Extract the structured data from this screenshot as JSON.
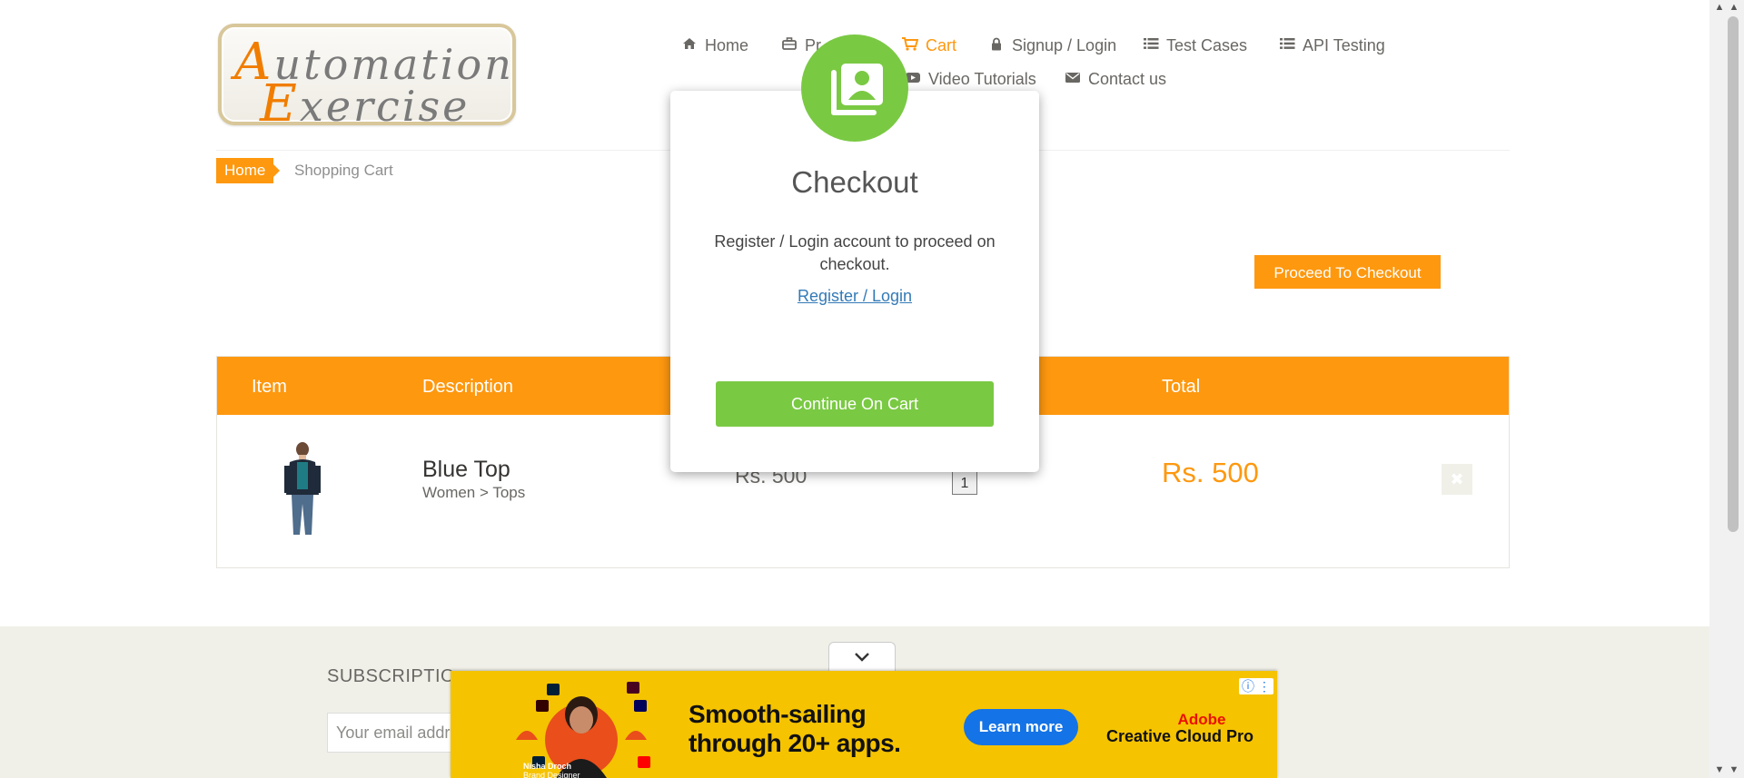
{
  "logo": {
    "line1_cap": "A",
    "line1_rest": "utomation",
    "line2_cap": "E",
    "line2_rest": "xercise"
  },
  "nav": {
    "items": [
      {
        "label": "Home",
        "icon": "home-icon"
      },
      {
        "label": "Pr",
        "icon": "briefcase-icon"
      },
      {
        "label": "Cart",
        "icon": "cart-icon",
        "active": true
      },
      {
        "label": "Signup / Login",
        "icon": "lock-icon"
      },
      {
        "label": "Test Cases",
        "icon": "list-icon"
      },
      {
        "label": "API Testing",
        "icon": "list-icon"
      },
      {
        "label": "Video Tutorials",
        "icon": "youtube-icon"
      },
      {
        "label": "Contact us",
        "icon": "envelope-icon"
      }
    ]
  },
  "breadcrumb": {
    "home": "Home",
    "current": "Shopping Cart"
  },
  "proceed_button": "Proceed To Checkout",
  "cart": {
    "headers": {
      "item": "Item",
      "description": "Description",
      "total": "Total"
    },
    "row": {
      "name": "Blue Top",
      "category": "Women > Tops",
      "price": "Rs. 500",
      "quantity": "1",
      "total": "Rs. 500",
      "delete_icon": "times-icon"
    }
  },
  "footer": {
    "subscription_title": "SUBSCRIPTIO",
    "email_placeholder": "Your email addre"
  },
  "ad": {
    "collapse_icon": "chevron-down-icon",
    "headline_line1": "Smooth-sailing",
    "headline_line2": "through 20+ apps.",
    "cta": "Learn more",
    "brand_line1": "Adobe",
    "brand_line2": "Creative Cloud Pro",
    "person_name": "Nisha Droch",
    "person_title": "Brand Designer"
  },
  "modal": {
    "title": "Checkout",
    "text": "Register / Login account to proceed on checkout.",
    "link": "Register / Login",
    "button": "Continue On Cart",
    "icon": "contact-book-icon"
  },
  "colors": {
    "accent": "#fe980f",
    "success": "#7ac943",
    "link": "#337ab7",
    "ad_bg": "#f5c300"
  }
}
